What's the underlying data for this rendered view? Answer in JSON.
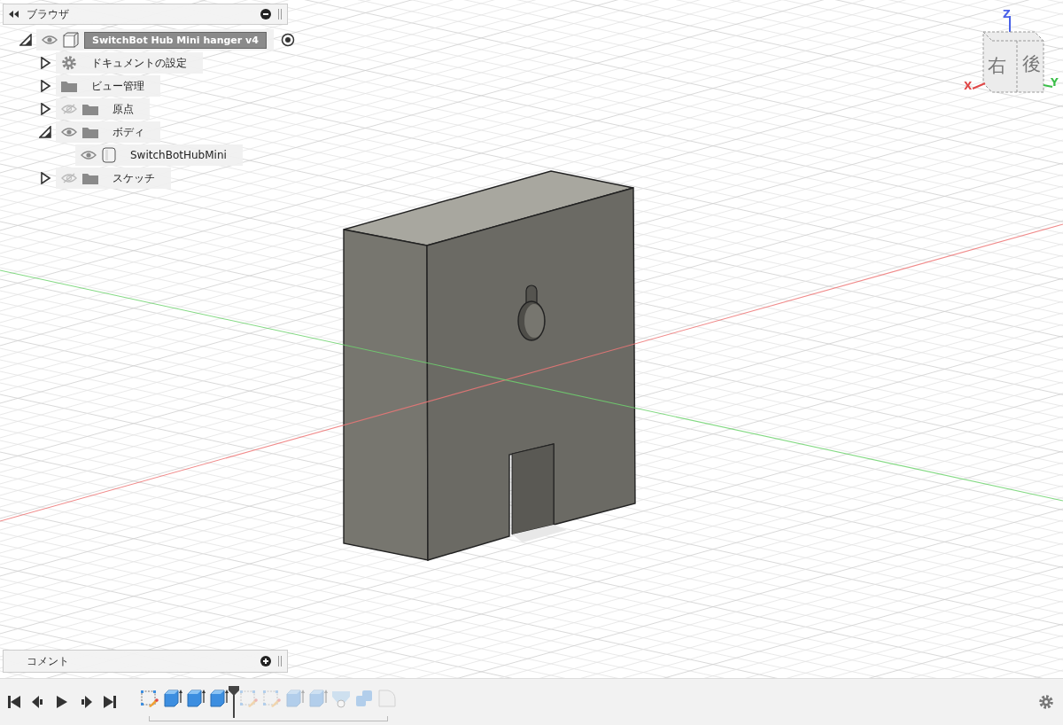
{
  "browser": {
    "title": "ブラウザ",
    "tree": [
      {
        "label": "SwitchBot Hub Mini hanger v4",
        "kind": "component",
        "expanded": true,
        "visible": true,
        "selected": true,
        "active": true,
        "children": [
          {
            "label": "ドキュメントの設定",
            "kind": "settings",
            "expanded": false
          },
          {
            "label": "ビュー管理",
            "kind": "folder",
            "expanded": false
          },
          {
            "label": "原点",
            "kind": "folder",
            "expanded": false,
            "visible": false
          },
          {
            "label": "ボディ",
            "kind": "folder",
            "expanded": true,
            "visible": true,
            "children": [
              {
                "label": "SwitchBotHubMini",
                "kind": "body",
                "visible": true
              }
            ]
          },
          {
            "label": "スケッチ",
            "kind": "folder",
            "expanded": false,
            "visible": false
          }
        ]
      }
    ]
  },
  "comment_panel": {
    "title": "コメント"
  },
  "viewcube": {
    "faces": [
      "右",
      "後"
    ],
    "axes": [
      {
        "label": "Z",
        "kind": "z"
      },
      {
        "label": "X",
        "kind": "x"
      },
      {
        "label": "Y",
        "kind": "y"
      }
    ]
  },
  "timeline": {
    "features": [
      {
        "kind": "sketch",
        "rolled_back": false
      },
      {
        "kind": "extrude",
        "rolled_back": false
      },
      {
        "kind": "extrude",
        "rolled_back": false
      },
      {
        "kind": "extrude",
        "rolled_back": false
      },
      {
        "kind": "sketch",
        "rolled_back": true
      },
      {
        "kind": "sketch",
        "rolled_back": true
      },
      {
        "kind": "extrude",
        "rolled_back": true
      },
      {
        "kind": "extrude",
        "rolled_back": true
      },
      {
        "kind": "hole",
        "rolled_back": true
      },
      {
        "kind": "combine",
        "rolled_back": true
      },
      {
        "kind": "fillet",
        "rolled_back": true
      }
    ]
  }
}
